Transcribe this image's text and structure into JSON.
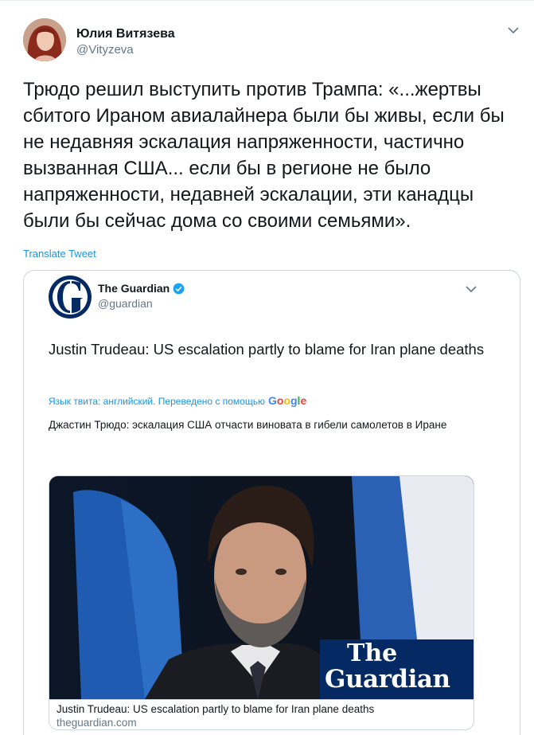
{
  "tweet": {
    "user_name": "Юлия Витязева",
    "user_handle": "@Vityzeva",
    "text": "Трюдо решил выступить против Трампа: «...жертвы сбитого Ираном авиалайнера были бы живы, если бы не недавняя эскалация напряженности, частично вызванная США... если бы в регионе не было напряженности, недавней эскалации, эти канадцы были бы сейчас дома со своими семьями».",
    "translate_label": "Translate Tweet"
  },
  "quoted_tweet": {
    "user_name": "The Guardian",
    "user_handle": "@guardian",
    "text": "Justin Trudeau: US escalation partly to blame for Iran plane deaths",
    "lang_note": "Язык твита: английский. Переведено с помощью",
    "translation_provider": "Google",
    "translated_text": "Джастин Трюдо: эскалация США отчасти виновата в гибели самолетов в Иране",
    "link_card": {
      "logo_line1": "The",
      "logo_line2": "Guardian",
      "title": "Justin Trudeau: US escalation partly to blame for Iran plane deaths",
      "domain": "theguardian.com"
    }
  },
  "colors": {
    "link": "#1b95e0",
    "secondary_text": "#657786",
    "border": "#ccd6dd",
    "guardian_blue": "#052962"
  },
  "icons": [
    "caret-down-icon",
    "verified-badge-icon",
    "guardian-g-logo"
  ]
}
